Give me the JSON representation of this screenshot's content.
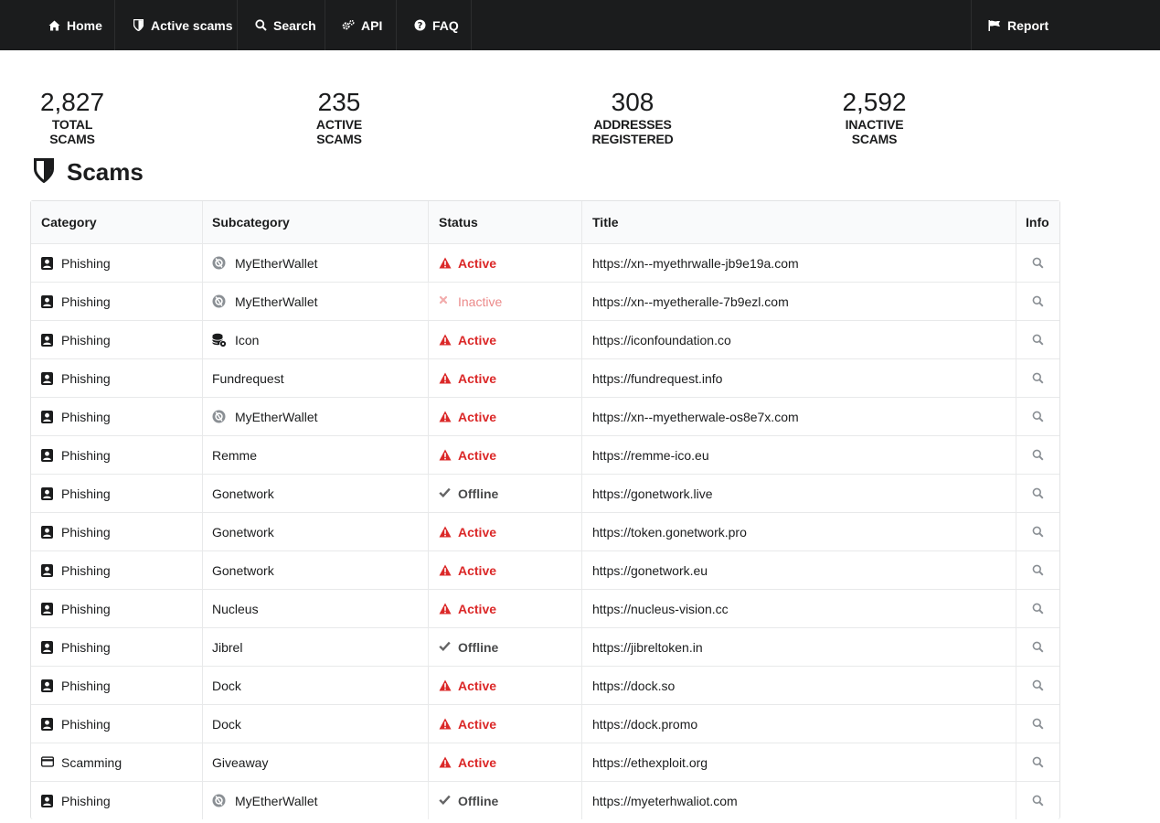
{
  "nav": {
    "items": [
      {
        "label": "Home",
        "icon": "home-icon"
      },
      {
        "label": "Active scams",
        "icon": "shield-icon"
      },
      {
        "label": "Search",
        "icon": "search-icon"
      },
      {
        "label": "API",
        "icon": "cogs-icon"
      },
      {
        "label": "FAQ",
        "icon": "question-circle-icon"
      }
    ],
    "report": {
      "label": "Report",
      "icon": "flag-icon"
    }
  },
  "stats": [
    {
      "value": "2,827",
      "label": "TOTAL SCAMS"
    },
    {
      "value": "235",
      "label": "ACTIVE SCAMS"
    },
    {
      "value": "308",
      "label": "ADDRESSES REGISTERED"
    },
    {
      "value": "2,592",
      "label": "INACTIVE SCAMS"
    }
  ],
  "heading": {
    "title": "Scams",
    "icon": "shield-icon"
  },
  "table": {
    "columns": [
      "Category",
      "Subcategory",
      "Status",
      "Title",
      "Info"
    ],
    "rows": [
      {
        "category": "Phishing",
        "category_icon": "user-badge-icon",
        "subcategory": "MyEtherWallet",
        "subcategory_icon": "myetherwallet-logo-icon",
        "status": "Active",
        "title": "https://xn--myethrwalle-jb9e19a.com"
      },
      {
        "category": "Phishing",
        "category_icon": "user-badge-icon",
        "subcategory": "MyEtherWallet",
        "subcategory_icon": "myetherwallet-logo-icon",
        "status": "Inactive",
        "title": "https://xn--myetheralle-7b9ezl.com"
      },
      {
        "category": "Phishing",
        "category_icon": "user-badge-icon",
        "subcategory": "Icon",
        "subcategory_icon": "icon-logo-icon",
        "status": "Active",
        "title": "https://iconfoundation.co"
      },
      {
        "category": "Phishing",
        "category_icon": "user-badge-icon",
        "subcategory": "Fundrequest",
        "subcategory_icon": "",
        "status": "Active",
        "title": "https://fundrequest.info"
      },
      {
        "category": "Phishing",
        "category_icon": "user-badge-icon",
        "subcategory": "MyEtherWallet",
        "subcategory_icon": "myetherwallet-logo-icon",
        "status": "Active",
        "title": "https://xn--myetherwale-os8e7x.com"
      },
      {
        "category": "Phishing",
        "category_icon": "user-badge-icon",
        "subcategory": "Remme",
        "subcategory_icon": "",
        "status": "Active",
        "title": "https://remme-ico.eu"
      },
      {
        "category": "Phishing",
        "category_icon": "user-badge-icon",
        "subcategory": "Gonetwork",
        "subcategory_icon": "",
        "status": "Offline",
        "title": "https://gonetwork.live"
      },
      {
        "category": "Phishing",
        "category_icon": "user-badge-icon",
        "subcategory": "Gonetwork",
        "subcategory_icon": "",
        "status": "Active",
        "title": "https://token.gonetwork.pro"
      },
      {
        "category": "Phishing",
        "category_icon": "user-badge-icon",
        "subcategory": "Gonetwork",
        "subcategory_icon": "",
        "status": "Active",
        "title": "https://gonetwork.eu"
      },
      {
        "category": "Phishing",
        "category_icon": "user-badge-icon",
        "subcategory": "Nucleus",
        "subcategory_icon": "",
        "status": "Active",
        "title": "https://nucleus-vision.cc"
      },
      {
        "category": "Phishing",
        "category_icon": "user-badge-icon",
        "subcategory": "Jibrel",
        "subcategory_icon": "",
        "status": "Offline",
        "title": "https://jibreltoken.in"
      },
      {
        "category": "Phishing",
        "category_icon": "user-badge-icon",
        "subcategory": "Dock",
        "subcategory_icon": "",
        "status": "Active",
        "title": "https://dock.so"
      },
      {
        "category": "Phishing",
        "category_icon": "user-badge-icon",
        "subcategory": "Dock",
        "subcategory_icon": "",
        "status": "Active",
        "title": "https://dock.promo"
      },
      {
        "category": "Scamming",
        "category_icon": "credit-card-icon",
        "subcategory": "Giveaway",
        "subcategory_icon": "",
        "status": "Active",
        "title": "https://ethexploit.org"
      },
      {
        "category": "Phishing",
        "category_icon": "user-badge-icon",
        "subcategory": "MyEtherWallet",
        "subcategory_icon": "myetherwallet-logo-icon",
        "status": "Offline",
        "title": "https://myeterhwaliot.com"
      }
    ]
  },
  "colors": {
    "navbar": "#1b1c1d",
    "active": "#db2828",
    "text": "#1b1c1d"
  }
}
